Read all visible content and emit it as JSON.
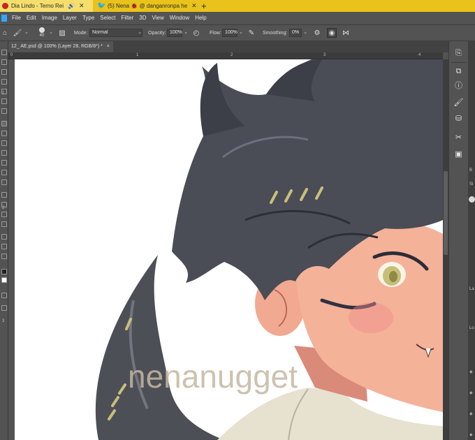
{
  "browser_tabs": [
    {
      "title": "Dia Lindo - Terno Rei",
      "active": true
    },
    {
      "title": "(5) Nena 🐞 @ danganronpa he",
      "active": false
    }
  ],
  "menu": [
    "File",
    "Edit",
    "Image",
    "Layer",
    "Type",
    "Select",
    "Filter",
    "3D",
    "View",
    "Window",
    "Help"
  ],
  "options": {
    "brush_size": "40",
    "mode_label": "Mode:",
    "mode_value": "Normal",
    "opacity_label": "Opacity:",
    "opacity_value": "100%",
    "flow_label": "Flow:",
    "flow_value": "100%",
    "smoothing_label": "Smoothing:",
    "smoothing_value": "0%"
  },
  "document": {
    "tab_title": "12_ AE.psd @ 100% (Layer 28, RGB/8*) *",
    "tab_close": "×"
  },
  "ruler": {
    "top_ticks": [
      "0",
      "1",
      "2",
      "3",
      "4"
    ],
    "left_ticks": [
      "1",
      "2",
      "3"
    ]
  },
  "panel_strip": {
    "labels": [
      "B",
      "Si",
      "La",
      "Lo"
    ]
  },
  "artwork": {
    "watermark": "nenanugget"
  },
  "colors": {
    "accent_tab": "#e9c31c",
    "ps_bg": "#535353",
    "canvas": "#ffffff"
  }
}
